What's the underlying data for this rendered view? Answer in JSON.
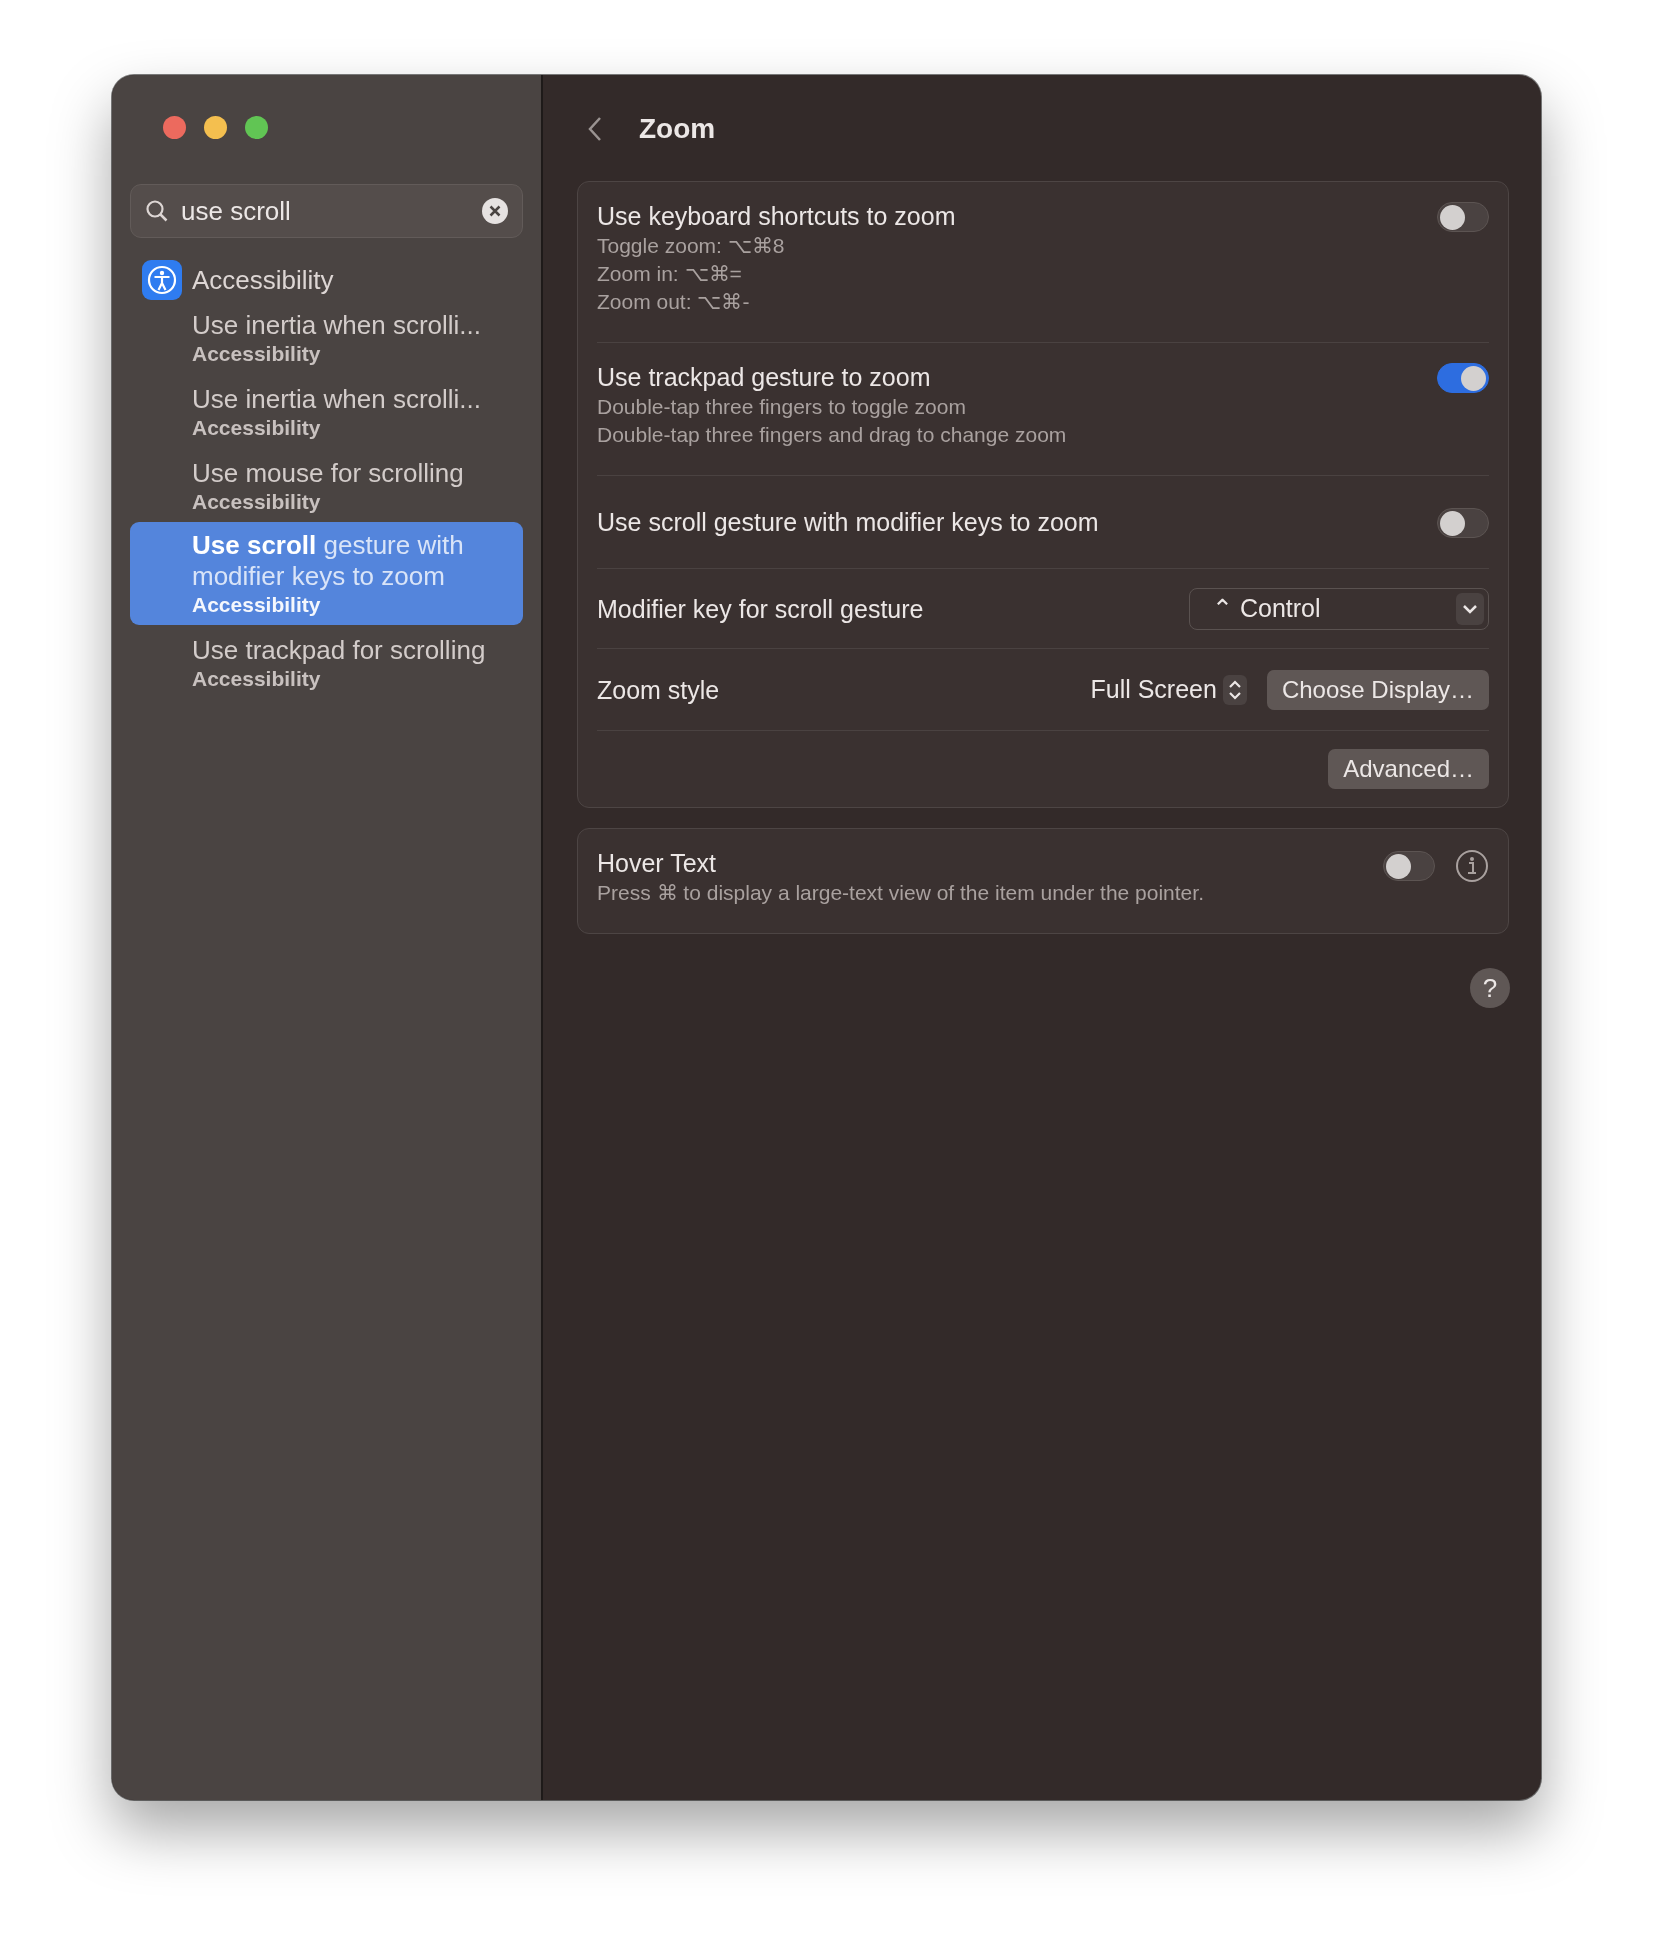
{
  "sidebar": {
    "search": {
      "value": "use scroll"
    },
    "group": {
      "label": "Accessibility"
    },
    "results": [
      {
        "title": "Use inertia when scrolli...",
        "subtitle": "Accessibility",
        "selected": false
      },
      {
        "title": "Use inertia when scrolli...",
        "subtitle": "Accessibility",
        "selected": false
      },
      {
        "title": "Use mouse for scrolling",
        "subtitle": "Accessibility",
        "selected": false
      },
      {
        "title": "**Use scroll** gesture with modifier keys to zoom",
        "subtitle": "Accessibility",
        "selected": true
      },
      {
        "title": "Use trackpad for scrolling",
        "subtitle": "Accessibility",
        "selected": false
      }
    ]
  },
  "header": {
    "title": "Zoom"
  },
  "cards": [
    {
      "rows": [
        {
          "kind": "toggle",
          "title": "Use keyboard shortcuts to zoom",
          "details": [
            "Toggle zoom: ⌥⌘8",
            "Zoom in: ⌥⌘=",
            "Zoom out: ⌥⌘-"
          ],
          "on": false
        },
        {
          "kind": "toggle",
          "title": "Use trackpad gesture to zoom",
          "details": [
            "Double-tap three fingers to toggle zoom",
            "Double-tap three fingers and drag to change zoom"
          ],
          "on": true
        },
        {
          "kind": "toggle",
          "title": "Use scroll gesture with modifier keys to zoom",
          "on": false
        },
        {
          "kind": "popup",
          "title": "Modifier key for scroll gesture",
          "value": "⌃ Control"
        },
        {
          "kind": "stepper",
          "title": "Zoom style",
          "value": "Full Screen",
          "button": "Choose Display…"
        },
        {
          "kind": "button",
          "button": "Advanced…"
        }
      ]
    },
    {
      "rows": [
        {
          "kind": "toggle",
          "title": "Hover Text",
          "details": [
            "Press ⌘ to display a large-text view of the item under the pointer."
          ],
          "on": false,
          "info": true
        }
      ]
    }
  ],
  "help": "?"
}
